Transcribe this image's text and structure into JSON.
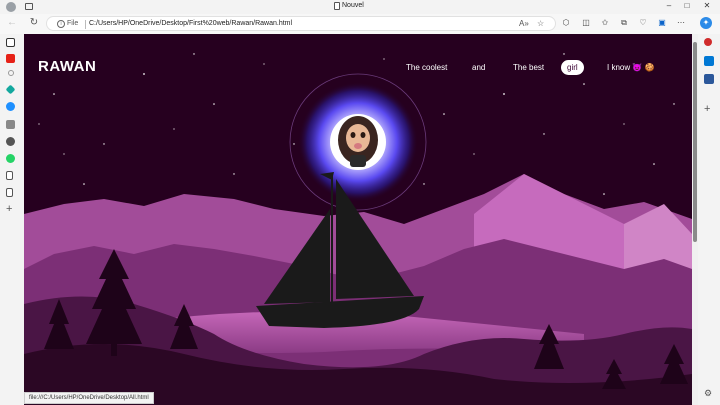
{
  "browser": {
    "tab_title": "Nouvel",
    "file_label": "File",
    "url": "C:/Users/HP/OneDrive/Desktop/First%20web/Rawan/Rawan.html",
    "status_url": "file:///C:/Users/HP/OneDrive/Desktop/All.html"
  },
  "page": {
    "logo": "RAWAN",
    "nav": [
      {
        "label": "The coolest"
      },
      {
        "label": "and"
      },
      {
        "label": "The best"
      },
      {
        "label": "girl"
      },
      {
        "label": "I know 👿 🍪"
      }
    ],
    "active_nav_index": 3
  },
  "colors": {
    "sky": "#26001f",
    "mountain_light": "#c15fb6",
    "mountain_mid": "#9b3f92",
    "mountain_dark": "#5a1e55",
    "hill_dark": "#2b0724",
    "moon_glow": "#4a3df0"
  }
}
